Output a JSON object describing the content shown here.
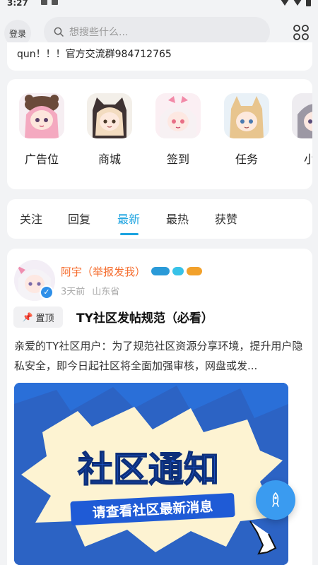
{
  "status_bar": {
    "time": "3:27"
  },
  "header": {
    "login_label": "登录",
    "search_placeholder": "想搜些什么..."
  },
  "notice": {
    "text": "qun！！！官方交流群984712765"
  },
  "features": [
    {
      "label": "广告位",
      "icon": "anime-avatar-bear-hat"
    },
    {
      "label": "商城",
      "icon": "anime-avatar-cat-hood"
    },
    {
      "label": "签到",
      "icon": "anime-avatar-pink-bow"
    },
    {
      "label": "任务",
      "icon": "anime-avatar-animal-ears"
    },
    {
      "label": "小",
      "icon": "anime-avatar-grey-hair"
    }
  ],
  "tabs": [
    {
      "label": "关注"
    },
    {
      "label": "回复"
    },
    {
      "label": "最新",
      "active": true
    },
    {
      "label": "最热"
    },
    {
      "label": "获赞"
    }
  ],
  "post": {
    "author": "阿宇（举报发我）",
    "time_ago": "3天前",
    "location": "山东省",
    "pinned_label": "置顶",
    "title": "TY社区发帖规范（必看）",
    "body": "亲爱的TY社区用户：为了规范社区资源分享环境，提升用户隐私安全，即今日起社区将全面加强审核，网盘或发...",
    "image": {
      "headline": "社区通知",
      "subline": "请查看社区最新消息"
    }
  },
  "colors": {
    "accent": "#1ba3e0",
    "author": "#f56c2d",
    "pin": "#e8414c",
    "fab": "#3a9bf0"
  }
}
